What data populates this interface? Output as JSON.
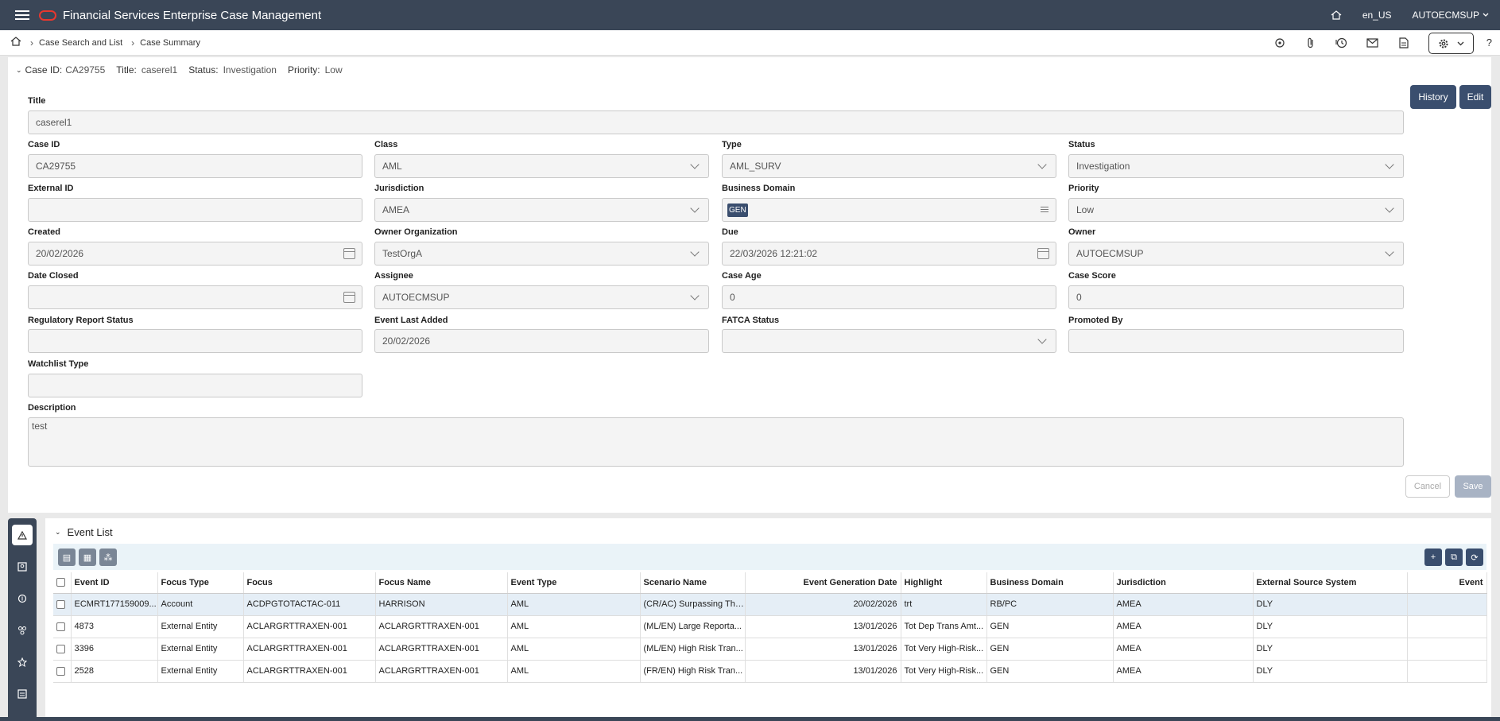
{
  "app": {
    "title": "Financial Services Enterprise Case Management",
    "locale": "en_US",
    "user": "AUTOECMSUP"
  },
  "breadcrumb": {
    "items": [
      "Case Search and List",
      "Case Summary"
    ]
  },
  "case_header": {
    "case_id_label": "Case ID:",
    "case_id": "CA29755",
    "title_label": "Title:",
    "title": "caserel1",
    "status_label": "Status:",
    "status": "Investigation",
    "priority_label": "Priority:",
    "priority": "Low"
  },
  "buttons": {
    "history": "History",
    "edit": "Edit",
    "cancel": "Cancel",
    "save": "Save"
  },
  "form": {
    "title": {
      "label": "Title",
      "value": "caserel1"
    },
    "case_id": {
      "label": "Case ID",
      "value": "CA29755"
    },
    "class": {
      "label": "Class",
      "value": "AML"
    },
    "type": {
      "label": "Type",
      "value": "AML_SURV"
    },
    "status": {
      "label": "Status",
      "value": "Investigation"
    },
    "external_id": {
      "label": "External ID",
      "value": ""
    },
    "jurisdiction": {
      "label": "Jurisdiction",
      "value": "AMEA"
    },
    "business_domain": {
      "label": "Business Domain",
      "value": "GEN"
    },
    "priority": {
      "label": "Priority",
      "value": "Low"
    },
    "created": {
      "label": "Created",
      "value": "20/02/2026"
    },
    "owner_org": {
      "label": "Owner Organization",
      "value": "TestOrgA"
    },
    "due": {
      "label": "Due",
      "value": "22/03/2026 12:21:02"
    },
    "owner": {
      "label": "Owner",
      "value": "AUTOECMSUP"
    },
    "date_closed": {
      "label": "Date Closed",
      "value": ""
    },
    "assignee": {
      "label": "Assignee",
      "value": "AUTOECMSUP"
    },
    "case_age": {
      "label": "Case Age",
      "value": "0"
    },
    "case_score": {
      "label": "Case Score",
      "value": "0"
    },
    "reg_report_status": {
      "label": "Regulatory Report Status",
      "value": ""
    },
    "event_last_added": {
      "label": "Event Last Added",
      "value": "20/02/2026"
    },
    "fatca_status": {
      "label": "FATCA Status",
      "value": ""
    },
    "promoted_by": {
      "label": "Promoted By",
      "value": ""
    },
    "watchlist_type": {
      "label": "Watchlist Type",
      "value": ""
    },
    "description": {
      "label": "Description",
      "value": "test"
    }
  },
  "event_list": {
    "title": "Event List",
    "columns": [
      "Event ID",
      "Focus Type",
      "Focus",
      "Focus Name",
      "Event Type",
      "Scenario Name",
      "Event Generation Date",
      "Highlight",
      "Business Domain",
      "Jurisdiction",
      "External Source System",
      "Event"
    ],
    "rows": [
      [
        "ECMRT177159009...",
        "Account",
        "ACDPGTOTACTAC-011",
        "HARRISON",
        "AML",
        "(CR/AC) Surpassing Thr...",
        "20/02/2026",
        "trt",
        "RB/PC",
        "AMEA",
        "DLY",
        ""
      ],
      [
        "4873",
        "External Entity",
        "ACLARGRTTRAXEN-001",
        "ACLARGRTTRAXEN-001",
        "AML",
        "(ML/EN) Large Reporta...",
        "13/01/2026",
        "Tot Dep Trans Amt...",
        "GEN",
        "AMEA",
        "DLY",
        ""
      ],
      [
        "3396",
        "External Entity",
        "ACLARGRTTRAXEN-001",
        "ACLARGRTTRAXEN-001",
        "AML",
        "(ML/EN) High Risk Tran...",
        "13/01/2026",
        "Tot Very High-Risk...",
        "GEN",
        "AMEA",
        "DLY",
        ""
      ],
      [
        "2528",
        "External Entity",
        "ACLARGRTTRAXEN-001",
        "ACLARGRTTRAXEN-001",
        "AML",
        "(FR/EN) High Risk Tran...",
        "13/01/2026",
        "Tot Very High-Risk...",
        "GEN",
        "AMEA",
        "DLY",
        ""
      ]
    ]
  }
}
